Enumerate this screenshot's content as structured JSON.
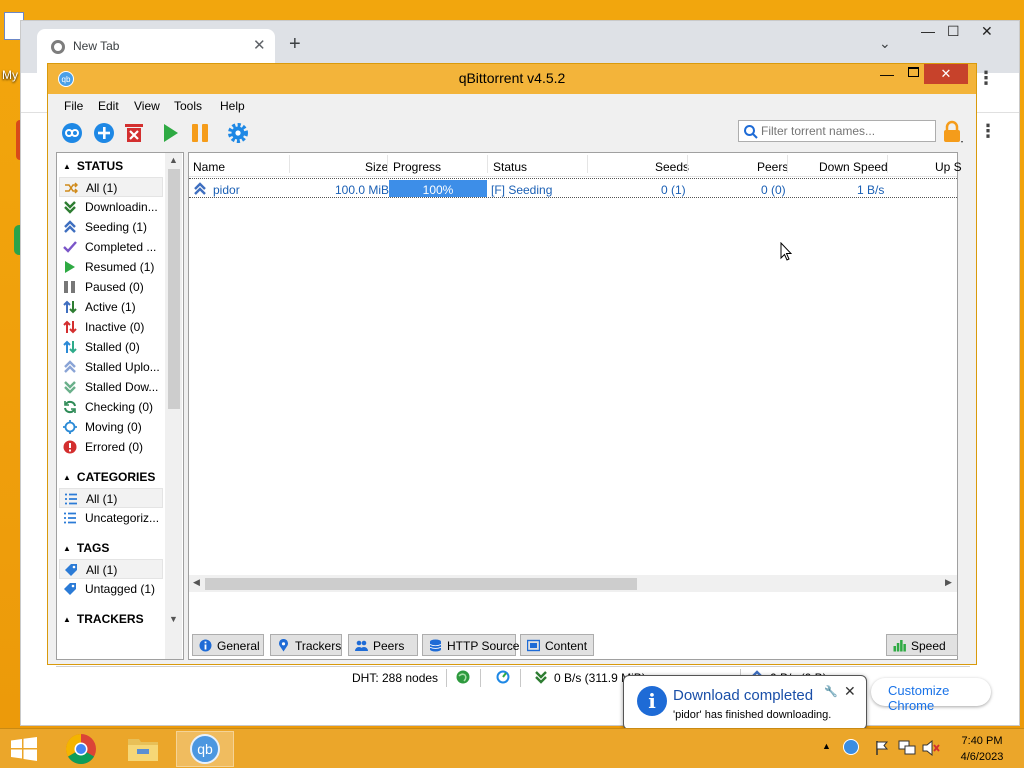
{
  "desktop": {
    "icon_label": "My"
  },
  "chrome": {
    "tab_title": "New Tab",
    "tab_close": "✕",
    "new_tab": "+",
    "tab_search_caret": "⌄",
    "win_min": "—",
    "win_max": "☐",
    "win_close": "✕",
    "menu": "⋮",
    "customize_label": "Customize Chrome"
  },
  "qbt": {
    "title": "qBittorrent v4.5.2",
    "app_icon_text": "qb",
    "win_min": "—",
    "win_close": "✕",
    "menu": [
      "File",
      "Edit",
      "View",
      "Tools",
      "Help"
    ],
    "search_placeholder": "Filter torrent names...",
    "sidebar": {
      "status_header": "STATUS",
      "status_items": [
        {
          "label": "All (1)",
          "icon": "shuffle-icon"
        },
        {
          "label": "Downloadin...",
          "icon": "double-down-icon"
        },
        {
          "label": "Seeding (1)",
          "icon": "double-up-icon"
        },
        {
          "label": "Completed ...",
          "icon": "checkmark-icon"
        },
        {
          "label": "Resumed (1)",
          "icon": "play-icon"
        },
        {
          "label": "Paused (0)",
          "icon": "pause-icon"
        },
        {
          "label": "Active (1)",
          "icon": "updown-arrows-icon"
        },
        {
          "label": "Inactive (0)",
          "icon": "updown-red-arrows-icon"
        },
        {
          "label": "Stalled (0)",
          "icon": "updown-blue-arrows-icon"
        },
        {
          "label": "Stalled Uplo...",
          "icon": "double-up-light-icon"
        },
        {
          "label": "Stalled Dow...",
          "icon": "double-down-light-icon"
        },
        {
          "label": "Checking (0)",
          "icon": "refresh-icon"
        },
        {
          "label": "Moving (0)",
          "icon": "move-icon"
        },
        {
          "label": "Errored (0)",
          "icon": "error-icon"
        }
      ],
      "categories_header": "CATEGORIES",
      "category_items": [
        {
          "label": "All (1)"
        },
        {
          "label": "Uncategoriz..."
        }
      ],
      "tags_header": "TAGS",
      "tag_items": [
        {
          "label": "All (1)"
        },
        {
          "label": "Untagged (1)"
        }
      ],
      "trackers_header": "TRACKERS"
    },
    "columns": [
      "Name",
      "Size",
      "Progress",
      "Status",
      "Seeds",
      "Peers",
      "Down Speed",
      "Up S"
    ],
    "torrents": [
      {
        "name": "pidor",
        "size": "100.0 MiB",
        "progress": "100%",
        "progress_value": 100,
        "status": "[F] Seeding",
        "seeds": "0 (1)",
        "peers": "0 (0)",
        "down_speed": "1 B/s"
      }
    ],
    "bottom_tabs": [
      "General",
      "Trackers",
      "Peers",
      "HTTP Sources",
      "Content"
    ],
    "speed_tab": "Speed",
    "statusbar": {
      "dht": "DHT: 288 nodes",
      "down": "0 B/s (311.9 MiB)",
      "up": "0 B/s (0 B)"
    }
  },
  "notification": {
    "title": "Download completed",
    "message": "'pidor' has finished downloading.",
    "close": "✕"
  },
  "taskbar": {
    "time": "7:40 PM",
    "date": "4/6/2023",
    "qb_label": "qb"
  },
  "colors": {
    "accent_orange": "#f3b43a",
    "progress_blue": "#3d8ee8",
    "close_red": "#c7422b",
    "link_blue": "#1a5fb4"
  }
}
